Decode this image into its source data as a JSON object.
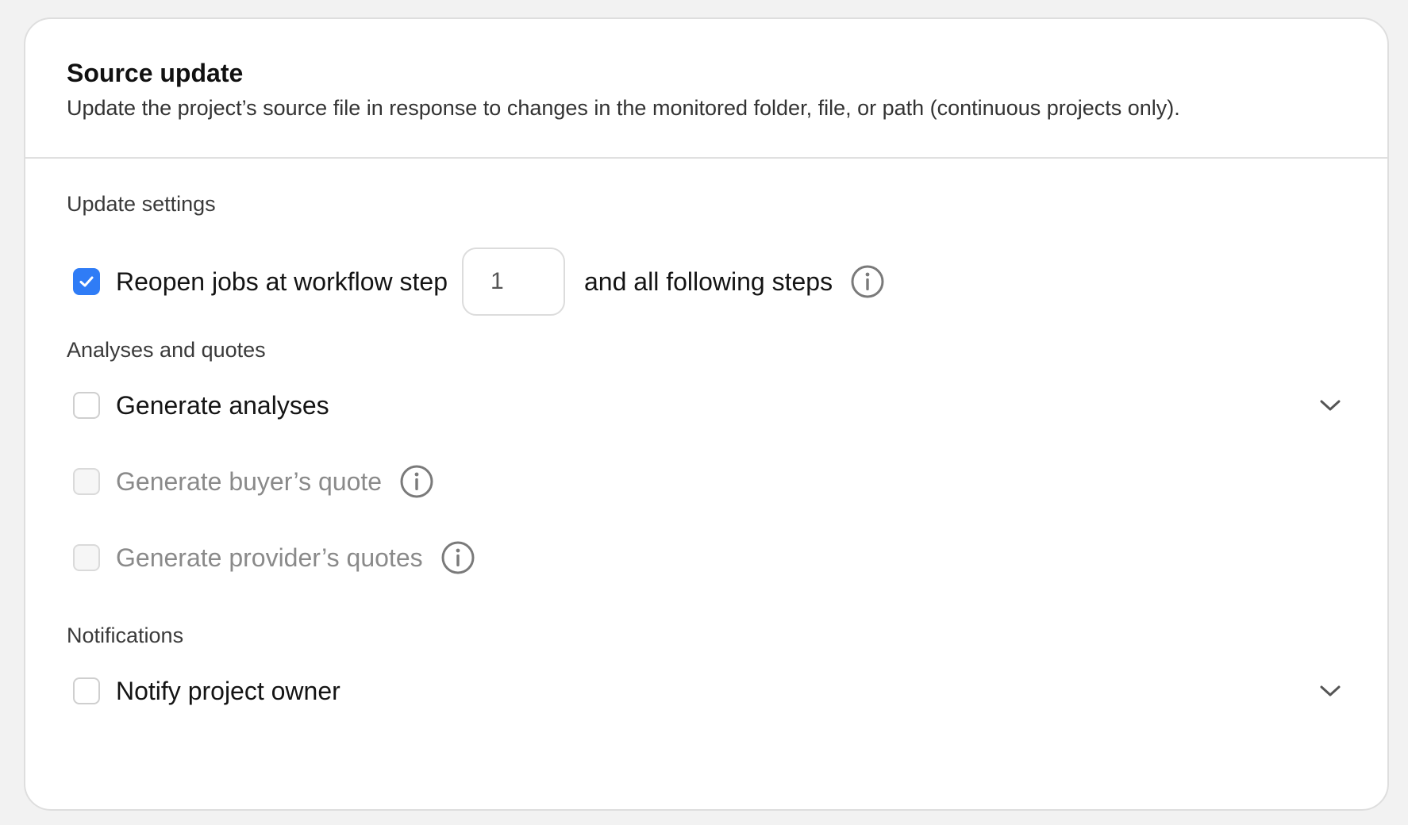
{
  "header": {
    "title": "Source update",
    "subtitle": "Update the project’s source file in response to changes in the monitored folder, file, or path (continuous projects only)."
  },
  "update_settings": {
    "label": "Update settings",
    "reopen": {
      "checked": true,
      "label": "Reopen jobs at workflow step",
      "step_value": "1",
      "after_label": "and all following steps",
      "info_icon": "info-icon"
    }
  },
  "analyses": {
    "label": "Analyses and quotes",
    "items": [
      {
        "label": "Generate analyses",
        "checked": false,
        "disabled": false,
        "expandable": true
      },
      {
        "label": "Generate buyer’s quote",
        "checked": false,
        "disabled": true,
        "info": true
      },
      {
        "label": "Generate provider’s quotes",
        "checked": false,
        "disabled": true,
        "info": true
      }
    ]
  },
  "notifications": {
    "label": "Notifications",
    "items": [
      {
        "label": "Notify project owner",
        "checked": false,
        "disabled": false,
        "expandable": true
      }
    ]
  },
  "colors": {
    "accent": "#2f7cf6",
    "text": "#141414",
    "muted_text": "#8a8a8a",
    "border": "#dedede",
    "background": "#f2f2f2"
  }
}
